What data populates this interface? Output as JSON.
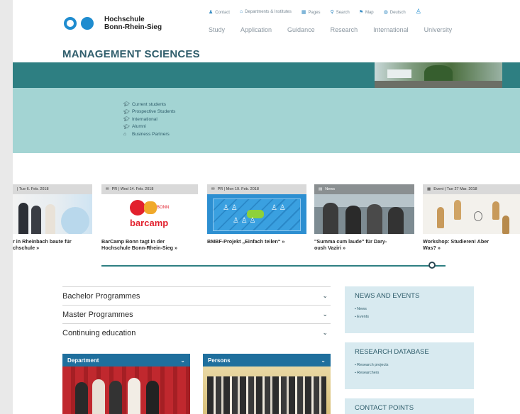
{
  "header": {
    "logo_line1": "Hochschule",
    "logo_line2": "Bonn-Rhein-Sieg",
    "utility": [
      "Contact",
      "Departments & Institutes",
      "Pages",
      "Search",
      "Map",
      "Deutsch"
    ],
    "nav": [
      "Study",
      "Application",
      "Guidance",
      "Research",
      "International",
      "University"
    ]
  },
  "faculty_title": "MANAGEMENT SCIENCES",
  "target_groups": [
    "Current students",
    "Prospective Students",
    "International",
    "Alumni",
    "Business Partners"
  ],
  "carousel": [
    {
      "meta": "| Tue 6. Feb. 2018",
      "cap1": "r in Rheinbach baute für",
      "cap2": "chschule »"
    },
    {
      "meta": "PR | Wed 14. Feb. 2018",
      "cap1": "BarCamp Bonn tagt in der",
      "cap2": "Hochschule Bonn-Rhein-Sieg »",
      "logo_top": "BONN",
      "logo_word": "barcamp"
    },
    {
      "meta": "PR | Mon 19. Feb. 2018",
      "cap1": "BMBF-Projekt „Einfach teilen“ »",
      "cap2": ""
    },
    {
      "meta": "News",
      "cap1": "\"Summa cum laude\" für Dary-",
      "cap2": "oush Vaziri »"
    },
    {
      "meta": "Event | Tue 27 Mar. 2018",
      "cap1": "Workshop: Studieren! Aber",
      "cap2": "Was? »"
    }
  ],
  "programmes": [
    "Bachelor Programmes",
    "Master Programmes",
    "Continuing education"
  ],
  "sidebar": {
    "news_title": "NEWS AND EVENTS",
    "news_items": [
      "News",
      "Events"
    ],
    "research_title": "RESEARCH DATABASE",
    "research_items": [
      "Research projects",
      "Researchers"
    ],
    "contact_title": "CONTACT POINTS"
  },
  "tiles": {
    "department": "Department",
    "persons": "Persons"
  },
  "colors": {
    "teal_dark": "#2e7f82",
    "teal_light": "#a3d4d3",
    "blue": "#1f6f9d",
    "sidebar_bg": "#d8eaf0"
  }
}
